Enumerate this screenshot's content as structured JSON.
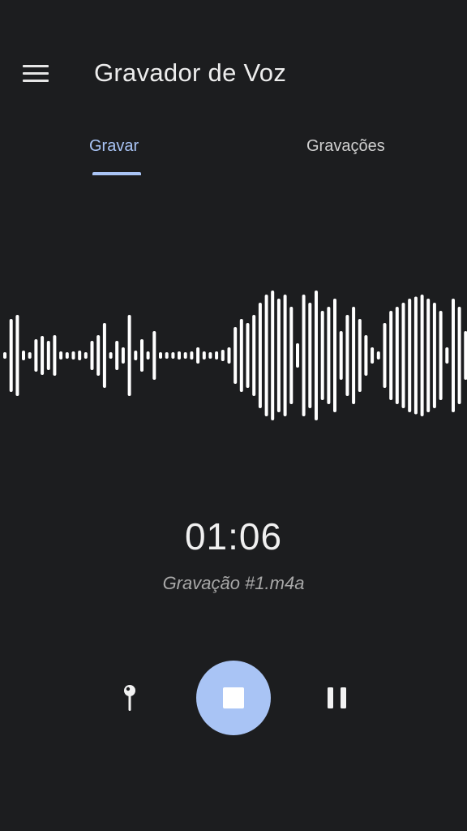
{
  "app": {
    "title": "Gravador de Voz"
  },
  "tabs": [
    {
      "label": "Gravar",
      "active": true
    },
    {
      "label": "Gravações",
      "active": false
    }
  ],
  "recording": {
    "elapsed": "01:06",
    "filename": "Gravação #1.m4a"
  },
  "icons": {
    "menu": "menu-icon",
    "pin": "pin-icon",
    "stop": "stop-icon",
    "pause": "pause-icon"
  },
  "colors": {
    "background": "#1c1d1f",
    "accent": "#a9c4f5",
    "waveform": "#ffffff"
  }
}
